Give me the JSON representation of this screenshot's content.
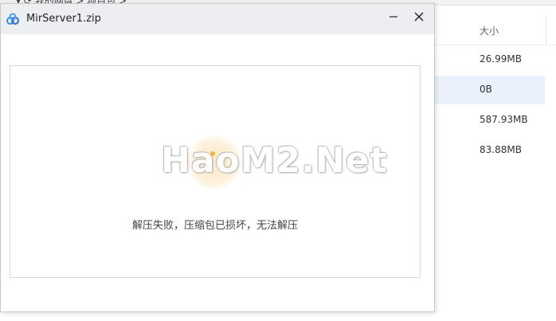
{
  "background": {
    "breadcrumb": "▾ ⟳  我的网盘 > 项目包 >",
    "columns": {
      "size": "大小"
    },
    "rows": [
      {
        "size": "26.99MB",
        "selected": false
      },
      {
        "size": "0B",
        "selected": true
      },
      {
        "size": "587.93MB",
        "selected": false
      },
      {
        "size": "83.88MB",
        "selected": false
      }
    ]
  },
  "dialog": {
    "title": "MirServer1.zip",
    "minimize_glyph": "—",
    "close_glyph": "✕",
    "message": "解压失败，压缩包已损坏，无法解压"
  },
  "watermark": "HaoM2.Net",
  "icons": {
    "app_logo": "cloud-logo-icon",
    "minimize": "minimize-icon",
    "close": "close-icon"
  },
  "colors": {
    "titlebar": "#eceef2",
    "selected_row": "#e9f2fc",
    "glow": "#f4b343"
  }
}
